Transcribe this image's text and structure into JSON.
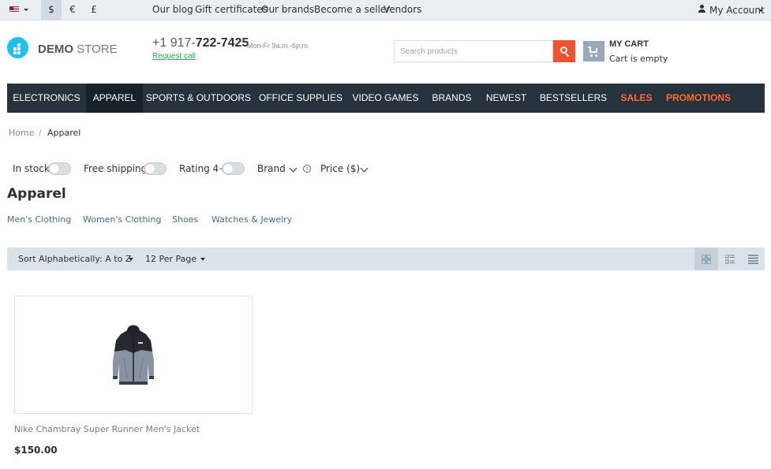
{
  "topbar": {
    "language_icon": "us-flag-icon",
    "currencies": [
      "$",
      "€",
      "£"
    ],
    "active_currency": "$",
    "links": [
      "Our blog",
      "Gift certificates",
      "Our brands",
      "Become a seller",
      "Vendors"
    ],
    "account_label": "My Account"
  },
  "header": {
    "logo_bold": "DEMO",
    "logo_light": "STORE",
    "phone_prefix": "+1 917-",
    "phone_main": "722-7425",
    "hours": "Mon-Fr 9a.m.-6p.m.",
    "request_call": "Request call",
    "search_placeholder": "Search products",
    "cart_title": "MY CART",
    "cart_status": "Cart is empty"
  },
  "nav": {
    "items": [
      "ELECTRONICS",
      "APPAREL",
      "SPORTS & OUTDOORS",
      "OFFICE SUPPLIES",
      "VIDEO GAMES",
      "BRANDS",
      "NEWEST",
      "BESTSELLERS",
      "SALES",
      "PROMOTIONS"
    ],
    "active": "APPAREL",
    "highlight_color": "#ff6a2c"
  },
  "breadcrumb": {
    "home": "Home",
    "separator": "/",
    "current": "Apparel"
  },
  "filters": {
    "in_stock": "In stock",
    "free_shipping": "Free shipping",
    "rating": "Rating 4+",
    "brand": "Brand",
    "info": "i",
    "price": "Price ($)"
  },
  "page_title": "Apparel",
  "subcategories": [
    "Men's Clothing",
    "Women's Clothing",
    "Shoes",
    "Watches & Jewelry"
  ],
  "sortbar": {
    "sort_label": "Sort Alphabetically: A to Z",
    "per_page_label": "12 Per Page",
    "views": [
      "grid-view-icon",
      "list-view-icon",
      "compact-list-icon"
    ],
    "active_view": "grid-view-icon"
  },
  "products": [
    {
      "name": "Nike Chambray Super Runner Men's Jacket",
      "price": "$150.00",
      "image": "jacket-image"
    }
  ],
  "colors": {
    "accent": "#1bc2ef",
    "search_button": "#f0522f",
    "nav_background": "#26323c"
  }
}
